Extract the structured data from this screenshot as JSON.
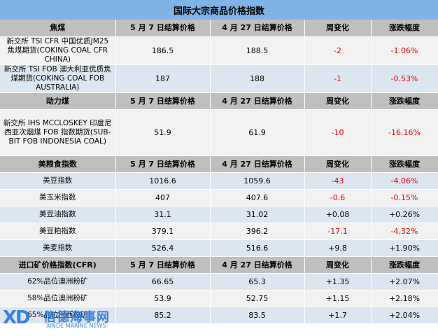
{
  "title": "国际大宗商品价格指数",
  "sections": [
    {
      "header": [
        "焦煤",
        "5 月 7 日结算价格",
        "4 月 27 日结算价格",
        "周变化",
        "涨跌幅度"
      ],
      "rows": [
        [
          "新交所 TSI CFR 中国优质JM25 焦煤期货(COKING COAL CFR CHINA)",
          "186.5",
          "188.5",
          "-2",
          "-1.06%"
        ],
        [
          "新交所 TSI FOB 澳大利亚优质焦煤期货(COKING COAL FOB AUSTRALIA)",
          "187",
          "188",
          "-1",
          "-0.53%"
        ]
      ]
    },
    {
      "header": [
        "动力煤",
        "5 月 7 日结算价格",
        "4 月 27 日结算价格",
        "周变化",
        "涨跌幅度"
      ],
      "rows": [
        [
          "新交所 IHS MCCLOSKEY 印度尼西亚次烟煤 FOB 指数期货(SUB-BIT FOB INDONESIA COAL)",
          "51.9",
          "61.9",
          "-10",
          "-16.16%"
        ]
      ]
    },
    {
      "header": [
        "美粮食指数",
        "5 月 7 日结算价格",
        "4 月 27 日结算价格",
        "周变化",
        "涨跌幅度"
      ],
      "rows": [
        [
          "美豆指数",
          "1016.6",
          "1059.6",
          "-43",
          "-4.06%"
        ],
        [
          "美玉米指数",
          "407",
          "407.6",
          "-0.6",
          "-0.15%"
        ],
        [
          "美豆油指数",
          "31.1",
          "31.02",
          "+0.08",
          "+0.26%"
        ],
        [
          "美豆粕指数",
          "379.1",
          "396.2",
          "-17.1",
          "-4.32%"
        ],
        [
          "美麦指数",
          "526.4",
          "516.6",
          "+9.8",
          "+1.90%"
        ]
      ]
    },
    {
      "header": [
        "进口矿价格指数(CFR)",
        "5 月 7 日结算价格",
        "4 月 27 日结算价格",
        "周变化",
        "涨跌幅度"
      ],
      "rows": [
        [
          "62%品位澳洲粉矿",
          "66.65",
          "65.3",
          "+1.35",
          "+2.07%"
        ],
        [
          "58%品位澳洲粉矿",
          "53.9",
          "52.75",
          "+1.15",
          "+2.18%"
        ],
        [
          "65%品位巴西粉矿",
          "85.2",
          "83.5",
          "+1.7",
          "+2.04%"
        ]
      ]
    }
  ],
  "watermark": {
    "logo": "XD",
    "cn": "信德海事网",
    "en": "XINDE MARINE NEWS"
  }
}
